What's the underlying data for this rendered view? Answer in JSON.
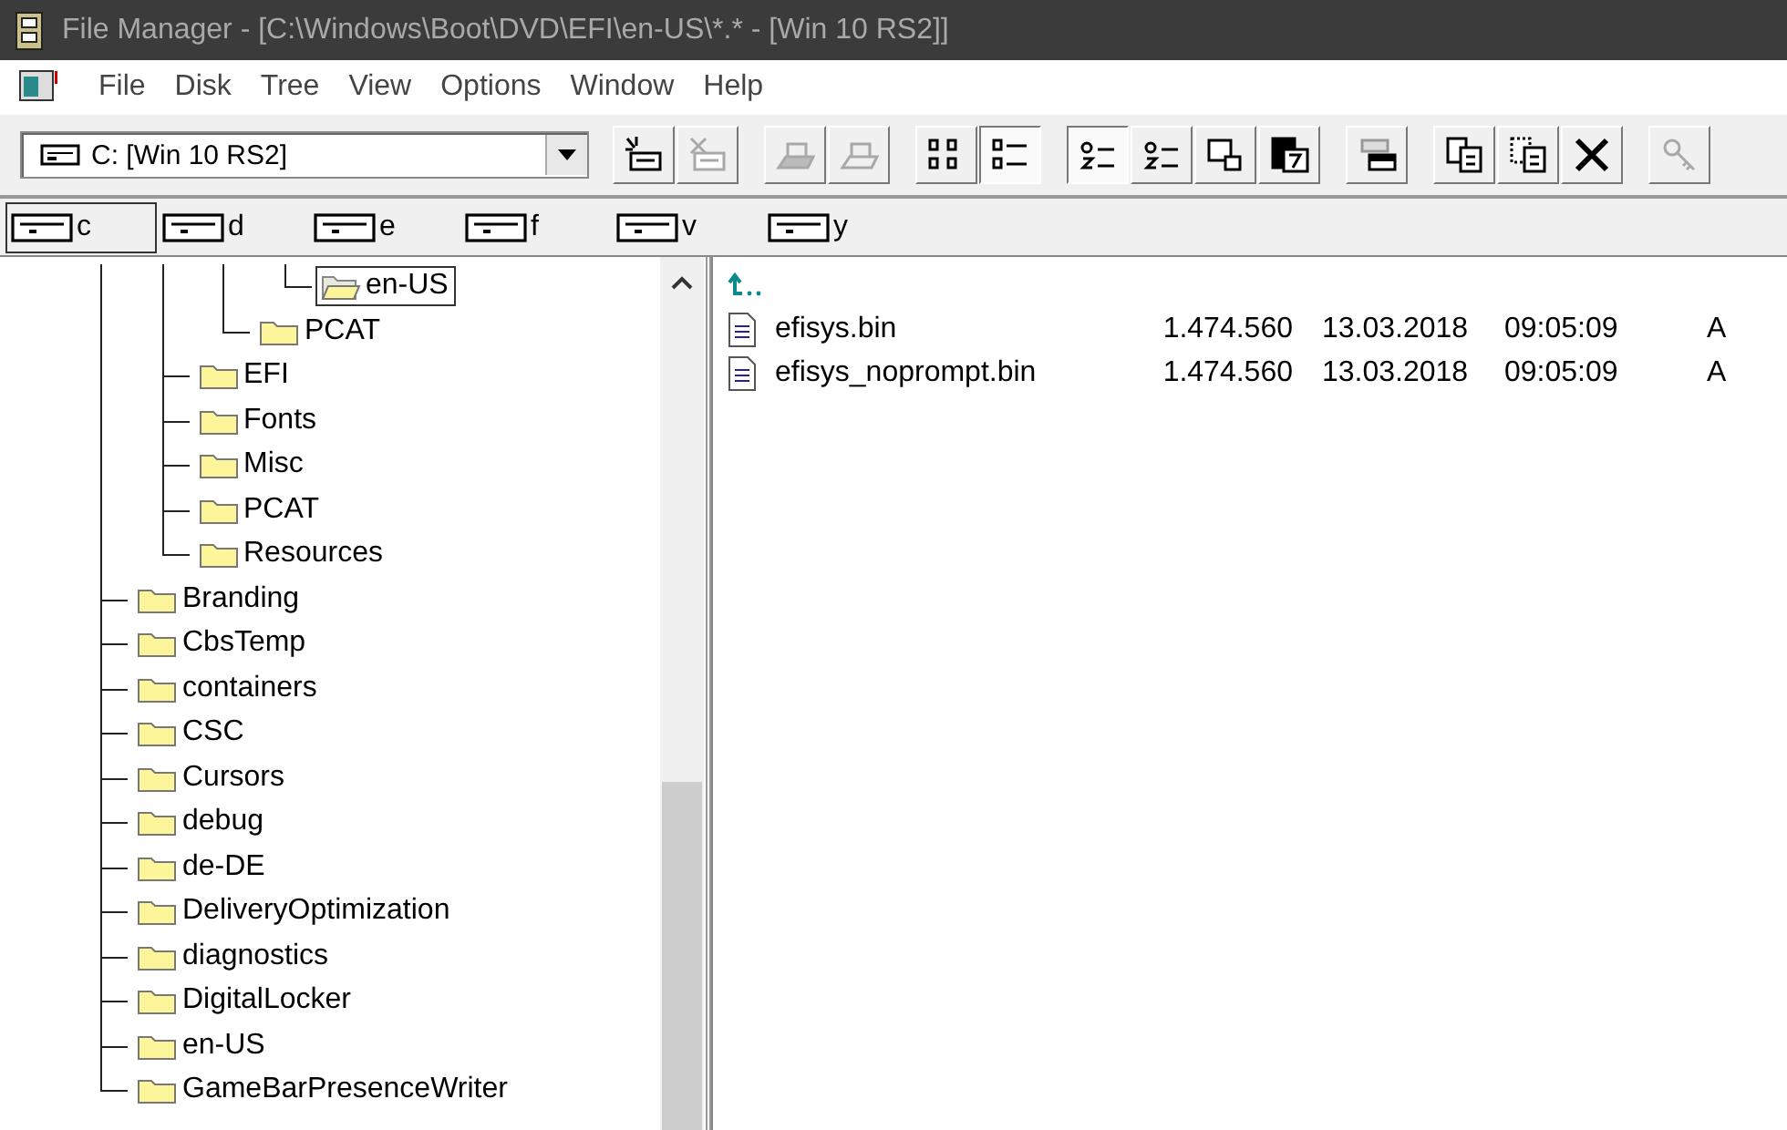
{
  "window": {
    "title": "File Manager - [C:\\Windows\\Boot\\DVD\\EFI\\en-US\\*.* - [Win 10 RS2]]"
  },
  "menu": [
    "File",
    "Disk",
    "Tree",
    "View",
    "Options",
    "Window",
    "Help"
  ],
  "drive_combo": {
    "value": "C: [Win 10 RS2]"
  },
  "toolbar": {
    "groups": [
      [
        {
          "kind": "connect",
          "disabled": false,
          "pressed": false
        },
        {
          "kind": "disconnect",
          "disabled": true,
          "pressed": false
        }
      ],
      [
        {
          "kind": "share",
          "disabled": true,
          "pressed": false
        },
        {
          "kind": "unshare",
          "disabled": true,
          "pressed": false
        }
      ],
      [
        {
          "kind": "icons-view",
          "disabled": false,
          "pressed": false
        },
        {
          "kind": "details-view",
          "disabled": false,
          "pressed": true
        }
      ],
      [
        {
          "kind": "sort-name",
          "disabled": false,
          "pressed": true
        },
        {
          "kind": "sort-type",
          "disabled": false,
          "pressed": false
        },
        {
          "kind": "new-window",
          "disabled": false,
          "pressed": false
        },
        {
          "kind": "compare",
          "disabled": false,
          "pressed": false
        }
      ],
      [
        {
          "kind": "split",
          "disabled": false,
          "pressed": false
        }
      ],
      [
        {
          "kind": "copy",
          "disabled": false,
          "pressed": false
        },
        {
          "kind": "move",
          "disabled": false,
          "pressed": false
        },
        {
          "kind": "delete",
          "disabled": false,
          "pressed": false
        }
      ],
      [
        {
          "kind": "security",
          "disabled": true,
          "pressed": false
        }
      ]
    ]
  },
  "drives": [
    {
      "letter": "c",
      "selected": true
    },
    {
      "letter": "d",
      "selected": false
    },
    {
      "letter": "e",
      "selected": false
    },
    {
      "letter": "f",
      "selected": false
    },
    {
      "letter": "v",
      "selected": false
    },
    {
      "letter": "y",
      "selected": false
    }
  ],
  "tree": {
    "items": [
      {
        "children": [
          {
            "children": [
              {
                "children": [
                  {
                    "name": "en-US",
                    "selected": true
                  }
                ]
              },
              {
                "name": "PCAT",
                "selected": false
              }
            ]
          },
          {
            "name": "EFI",
            "selected": false
          },
          {
            "name": "Fonts",
            "selected": false
          },
          {
            "name": "Misc",
            "selected": false
          },
          {
            "name": "PCAT",
            "selected": false
          },
          {
            "name": "Resources",
            "selected": false
          }
        ]
      },
      {
        "name": "Branding",
        "selected": false
      },
      {
        "name": "CbsTemp",
        "selected": false
      },
      {
        "name": "containers",
        "selected": false
      },
      {
        "name": "CSC",
        "selected": false
      },
      {
        "name": "Cursors",
        "selected": false
      },
      {
        "name": "debug",
        "selected": false
      },
      {
        "name": "de-DE",
        "selected": false
      },
      {
        "name": "DeliveryOptimization",
        "selected": false
      },
      {
        "name": "diagnostics",
        "selected": false
      },
      {
        "name": "DigitalLocker",
        "selected": false
      },
      {
        "name": "en-US",
        "selected": false
      },
      {
        "name": "GameBarPresenceWriter",
        "selected": false
      }
    ]
  },
  "files": {
    "rows": [
      {
        "kind": "parent"
      },
      {
        "kind": "file",
        "name": "efisys.bin",
        "size": "1.474.560",
        "date": "13.03.2018",
        "time": "09:05:09",
        "attributes": "A"
      },
      {
        "kind": "file",
        "name": "efisys_noprompt.bin",
        "size": "1.474.560",
        "date": "13.03.2018",
        "time": "09:05:09",
        "attributes": "A"
      }
    ]
  }
}
